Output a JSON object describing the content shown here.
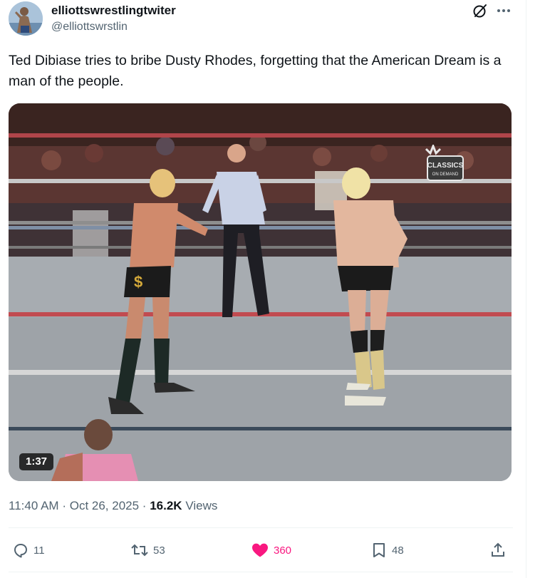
{
  "author": {
    "display_name": "elliottswrestlingtwiter",
    "handle": "@elliottswrstlin",
    "avatar_icon": "avatar-wrestler-photo"
  },
  "header_icons": [
    "grok-icon",
    "more-options-icon"
  ],
  "tweet": {
    "text": "Ted Dibiase tries to bribe Dusty Rhodes, forgetting that the American Dream is a man of the people."
  },
  "media": {
    "type": "video",
    "duration": "1:37",
    "logo_text_1": "CLASSICS",
    "logo_text_2": "ON DEMAND"
  },
  "meta": {
    "time": "11:40 AM",
    "separator": "·",
    "date": "Oct 26, 2025",
    "views_count": "16.2K",
    "views_label": "Views"
  },
  "actions": {
    "replies": "11",
    "reposts": "53",
    "likes": "360",
    "bookmarks": "48"
  },
  "colors": {
    "like_active": "#f91880",
    "text_secondary": "#536471",
    "text_primary": "#0f1419"
  }
}
